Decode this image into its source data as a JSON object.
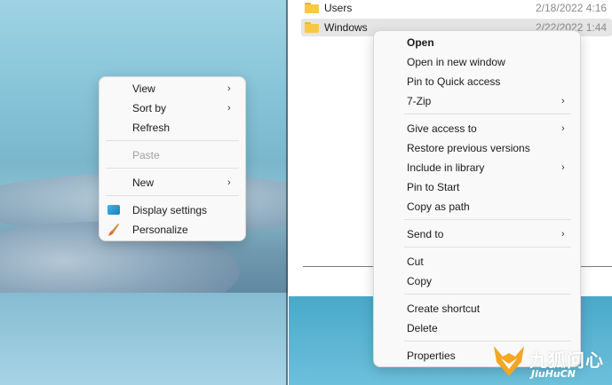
{
  "explorer": {
    "files": [
      {
        "name": "Users",
        "date": "2/18/2022 4:16"
      },
      {
        "name": "Windows",
        "date": "2/22/2022 1:44"
      }
    ]
  },
  "desktop_menu": {
    "items": [
      {
        "label": "View",
        "submenu": true
      },
      {
        "label": "Sort by",
        "submenu": true
      },
      {
        "label": "Refresh"
      },
      {
        "label": "Paste",
        "disabled": true
      },
      {
        "label": "New",
        "submenu": true
      },
      {
        "label": "Display settings",
        "icon": "display-icon"
      },
      {
        "label": "Personalize",
        "icon": "paintbrush-icon"
      }
    ]
  },
  "context_menu": {
    "items": [
      {
        "label": "Open",
        "bold": true
      },
      {
        "label": "Open in new window"
      },
      {
        "label": "Pin to Quick access"
      },
      {
        "label": "7-Zip",
        "submenu": true
      },
      {
        "label": "Give access to",
        "submenu": true
      },
      {
        "label": "Restore previous versions"
      },
      {
        "label": "Include in library",
        "submenu": true
      },
      {
        "label": "Pin to Start"
      },
      {
        "label": "Copy as path"
      },
      {
        "label": "Send to",
        "submenu": true
      },
      {
        "label": "Cut"
      },
      {
        "label": "Copy"
      },
      {
        "label": "Create shortcut"
      },
      {
        "label": "Delete"
      },
      {
        "label": "Properties"
      }
    ]
  },
  "watermark": {
    "brand_cn": "九狐问心",
    "brand_en": "JiuHuCN"
  },
  "colors": {
    "folder": "#f7c844",
    "menu_bg": "#f9f9f9",
    "selection": "#e5e5e5",
    "watermark_orange": "#f5a623"
  }
}
